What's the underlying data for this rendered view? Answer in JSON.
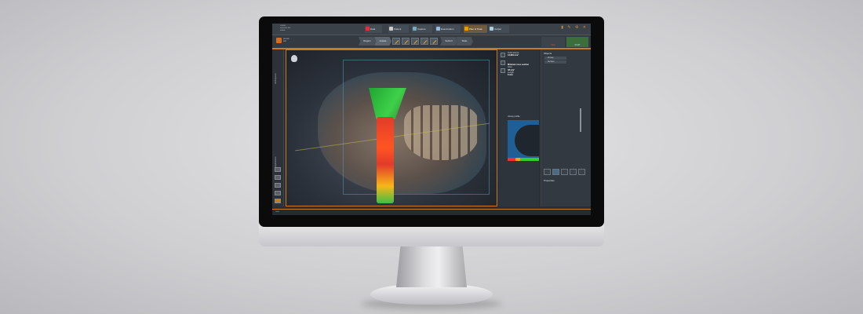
{
  "colors": {
    "accent": "#c97a22",
    "green": "#3fd04a",
    "red": "#e23b2a"
  },
  "topbar": {
    "tabs": [
      {
        "label": "Data",
        "icon": "patient-icon"
      },
      {
        "label": "Patient",
        "icon": "patient-record-icon"
      },
      {
        "label": "Capture",
        "icon": "capture-icon"
      },
      {
        "label": "Examination",
        "icon": "examination-icon"
      },
      {
        "label": "Plan & Treat",
        "icon": "plan-icon"
      },
      {
        "label": "Output",
        "icon": "output-icon"
      }
    ]
  },
  "workflow": {
    "steps": [
      "Region",
      "Isolate",
      "Submit",
      "Slide"
    ]
  },
  "brands": {
    "left": "Pano",
    "right": "SICAT"
  },
  "sidebar": {
    "tabs": [
      "Workspaces",
      "Applications"
    ]
  },
  "results": {
    "heading": "Total volume",
    "volume": "12,984 mm³",
    "section": "Minimal cross section",
    "area_label": "Area",
    "area_value": "48 mm²",
    "width_label": "Length",
    "width_value": "8 mm",
    "profile_title": "Airway profile"
  },
  "objects": {
    "title": "Objects",
    "items": [
      "Airway",
      "Surface"
    ],
    "properties": "Properties"
  }
}
